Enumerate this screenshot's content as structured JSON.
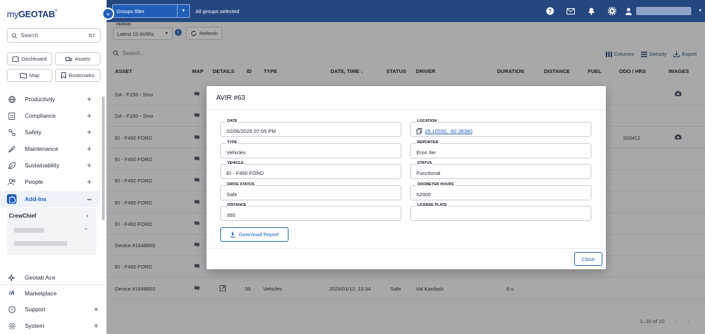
{
  "app": {
    "logo_prefix": "my",
    "logo_name": "GEOTAB",
    "logo_tm": "®"
  },
  "sidebar": {
    "search_placeholder": "Search",
    "search_shortcut": "⌘F",
    "quick_buttons": [
      "Dashboard",
      "Assets",
      "Map",
      "Bookmarks"
    ],
    "nav_items": [
      "Productivity",
      "Compliance",
      "Safety",
      "Maintenance",
      "Sustainability",
      "People",
      "Add-Ins"
    ],
    "active_item": "Add-Ins",
    "sub_item": "CrewChief",
    "bottom_items": [
      "Geotab Ace",
      "Marketplace",
      "Support",
      "System"
    ]
  },
  "topbar": {
    "groups_filter": "Groups filter",
    "groups_status": "All groups selected"
  },
  "toolbar": {
    "period_label": "PERIOD",
    "period_value": "Latest 10 AVIRs",
    "refresh_label": "Refresh",
    "search_placeholder": "Search...",
    "columns_label": "Columns",
    "density_label": "Density",
    "export_label": "Export"
  },
  "table": {
    "headers": [
      "ASSET",
      "MAP",
      "DETAILS",
      "ID",
      "TYPE",
      "DATE, TIME",
      "STATUS",
      "DRIVER",
      "DURATION",
      "DISTANCE",
      "FUEL",
      "ODO / HRS",
      "IMAGES"
    ],
    "rows": [
      {
        "asset": "DA - F150 - Sino",
        "id": "",
        "type": "",
        "date": "",
        "status": "",
        "driver": "",
        "duration": "",
        "odo": "",
        "image": true
      },
      {
        "asset": "DA - F150 - Sino",
        "id": "",
        "type": "",
        "date": "",
        "status": "",
        "driver": "",
        "duration": "",
        "odo": "",
        "image": false
      },
      {
        "asset": "EI - F450 FORD",
        "id": "",
        "type": "",
        "date": "",
        "status": "",
        "driver": "",
        "duration": "",
        "odo": "203412",
        "image": true
      },
      {
        "asset": "EI - F450 FORD",
        "id": "",
        "type": "",
        "date": "",
        "status": "",
        "driver": "",
        "duration": "",
        "odo": "",
        "image": false
      },
      {
        "asset": "EI - F450 FORD",
        "id": "",
        "type": "",
        "date": "",
        "status": "",
        "driver": "",
        "duration": "",
        "odo": "",
        "image": false
      },
      {
        "asset": "EI - F450 FORD",
        "id": "",
        "type": "",
        "date": "",
        "status": "",
        "driver": "",
        "duration": "",
        "odo": "",
        "image": false
      },
      {
        "asset": "EI - F450 FORD",
        "id": "",
        "type": "",
        "date": "",
        "status": "",
        "driver": "",
        "duration": "",
        "odo": "",
        "image": false
      },
      {
        "asset": "Device #1648850",
        "id": "",
        "type": "",
        "date": "",
        "status": "",
        "driver": "",
        "duration": "",
        "odo": "",
        "image": false
      },
      {
        "asset": "EI - F450 FORD",
        "id": "",
        "type": "",
        "date": "",
        "status": "",
        "driver": "",
        "duration": "",
        "odo": "",
        "image": false
      },
      {
        "asset": "Device #1648850",
        "id": "56",
        "type": "Vehicles",
        "date": "2025/01/12, 13:34",
        "status": "Safe",
        "driver": "Val Kardash",
        "duration": "6 s",
        "odo": "",
        "image": false
      }
    ],
    "pagination": "1–10 of 10"
  },
  "modal": {
    "title": "AVIR #63",
    "fields": {
      "date": {
        "label": "DATE",
        "value": "02/06/2025 07:05 PM"
      },
      "location": {
        "label": "LOCATION",
        "value": "28.10550, -82.38380"
      },
      "type": {
        "label": "TYPE",
        "value": "Vehicles"
      },
      "reporter": {
        "label": "REPORTER",
        "value": "Eron Iler"
      },
      "vehicle": {
        "label": "VEHICLE",
        "value": "EI - F450 FORD"
      },
      "status": {
        "label": "STATUS",
        "value": "Functional"
      },
      "drive_status": {
        "label": "DRIVE STATUS",
        "value": "Safe"
      },
      "odometer_hours": {
        "label": "ODOMETER HOURS",
        "value": "62000"
      },
      "distance": {
        "label": "DISTANCE",
        "value": "350"
      },
      "license_plate": {
        "label": "LICENSE PLATE",
        "value": ""
      }
    },
    "download_label": "Download Report",
    "close_label": "Close"
  },
  "colors": {
    "brand_navy": "#25477f",
    "accent_blue": "#1f5fb8"
  }
}
